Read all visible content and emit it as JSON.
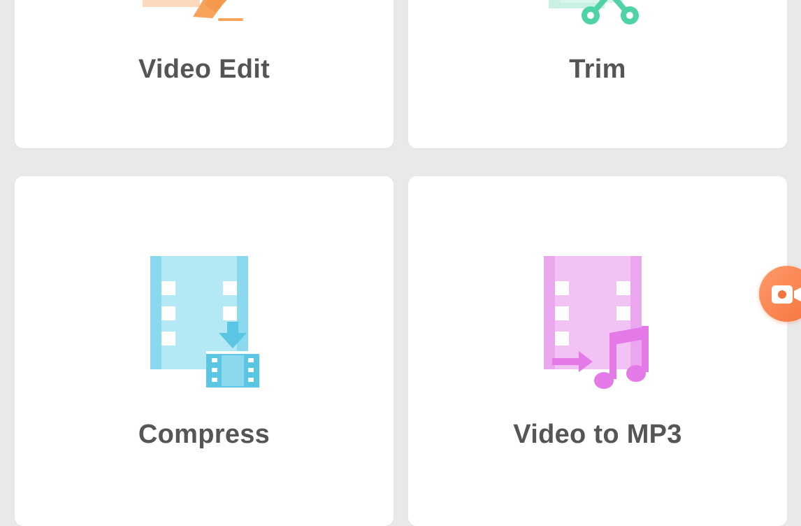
{
  "tools": {
    "video_edit": {
      "label": "Video Edit",
      "icon": "video-edit-icon",
      "color": "#f7a35c"
    },
    "trim": {
      "label": "Trim",
      "icon": "trim-scissors-icon",
      "color": "#4fd3a6"
    },
    "compress": {
      "label": "Compress",
      "icon": "compress-icon",
      "color": "#5ac6e3"
    },
    "video_to_mp3": {
      "label": "Video to MP3",
      "icon": "video-to-mp3-icon",
      "color": "#e37ae8"
    }
  },
  "floating_button": {
    "icon": "screen-record-icon",
    "color": "#f5743e"
  },
  "theme": {
    "background": "#e9e9e9",
    "card": "#ffffff",
    "label_color": "#555555"
  }
}
